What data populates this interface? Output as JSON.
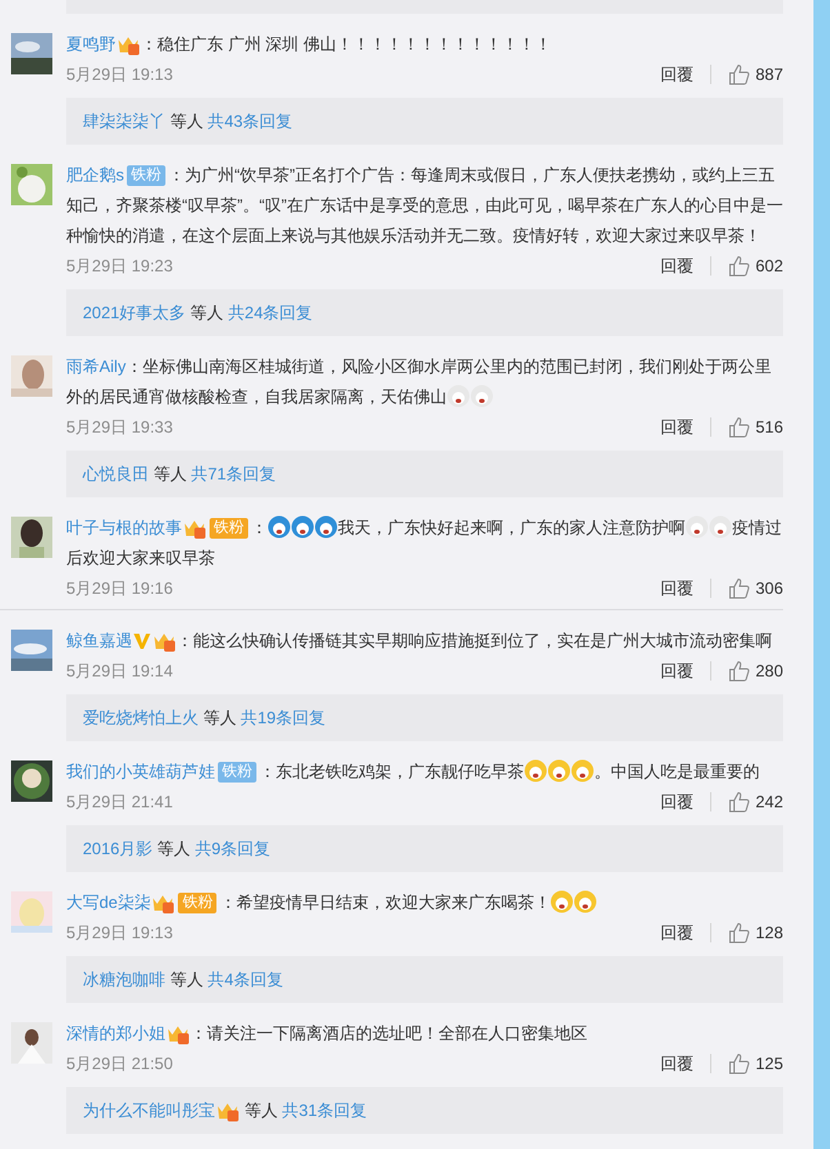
{
  "partial_reply_panel": true,
  "comments": [
    {
      "user": "夏鸣野",
      "badges": [
        {
          "kind": "crown"
        }
      ],
      "content": [
        {
          "kind": "text",
          "text": "：稳住广东 广州 深圳 佛山！！！！！！！！！！！！！"
        }
      ],
      "time": "5月29日 19:13",
      "reply_label": "回覆",
      "likes": "887",
      "replies": {
        "users": [
          {
            "name": "肆柒柒柒丫"
          }
        ],
        "suffix": "等人",
        "total": "共43条回复"
      }
    },
    {
      "user": "肥企鹅s",
      "badges": [
        {
          "kind": "fan",
          "text": "铁粉",
          "color": "#7ab8ea"
        }
      ],
      "content": [
        {
          "kind": "text",
          "text": "：为广州“饮早茶”正名打个广告：每逢周末或假日，广东人便扶老携幼，或约上三五知己，齐聚茶楼“叹早茶”。“叹”在广东话中是享受的意思，由此可见，喝早茶在广东人的心目中是一种愉快的消遣，在这个层面上来说与其他娱乐活动并无二致。疫情好转，欢迎大家过来叹早茶！"
        }
      ],
      "time": "5月29日 19:23",
      "reply_label": "回覆",
      "likes": "602",
      "replies": {
        "users": [
          {
            "name": "2021好事太多"
          }
        ],
        "suffix": "等人",
        "total": "共24条回复"
      }
    },
    {
      "user": "雨希Aily",
      "content": [
        {
          "kind": "text",
          "text": "：坐标佛山南海区桂城街道，风险小区御水岸两公里内的范围已封闭，我们刚处于两公里外的居民通宵做核酸检查，自我居家隔离，天佑佛山"
        },
        {
          "kind": "emoticon",
          "color": "#e8e8e8"
        },
        {
          "kind": "emoticon",
          "color": "#e8e8e8"
        }
      ],
      "time": "5月29日 19:33",
      "reply_label": "回覆",
      "likes": "516",
      "replies": {
        "users": [
          {
            "name": "心悦良田"
          }
        ],
        "suffix": "等人",
        "total": "共71条回复"
      }
    },
    {
      "user": "叶子与根的故事",
      "badges": [
        {
          "kind": "crown"
        },
        {
          "kind": "fan",
          "text": "铁粉",
          "color": "#f5a623"
        }
      ],
      "content": [
        {
          "kind": "text",
          "text": "："
        },
        {
          "kind": "emoticon",
          "color": "#2f8fd8"
        },
        {
          "kind": "emoticon",
          "color": "#2f8fd8"
        },
        {
          "kind": "emoticon",
          "color": "#2f8fd8"
        },
        {
          "kind": "text",
          "text": "我天，广东快好起来啊，广东的家人注意防护啊"
        },
        {
          "kind": "emoticon",
          "color": "#e8e8e8"
        },
        {
          "kind": "emoticon",
          "color": "#e8e8e8"
        },
        {
          "kind": "text",
          "text": "疫情过后欢迎大家来叹早茶"
        }
      ],
      "time": "5月29日 19:16",
      "reply_label": "回覆",
      "likes": "306"
    },
    {
      "user": "鲸鱼嘉遇",
      "badges": [
        {
          "kind": "verified"
        },
        {
          "kind": "crown"
        }
      ],
      "content": [
        {
          "kind": "text",
          "text": "：能这么快确认传播链其实早期响应措施挺到位了，实在是广州大城市流动密集啊"
        }
      ],
      "time": "5月29日 19:14",
      "reply_label": "回覆",
      "likes": "280",
      "replies": {
        "users": [
          {
            "name": "爱吃烧烤怕上火"
          }
        ],
        "suffix": "等人",
        "total": "共19条回复"
      }
    },
    {
      "user": "我们的小英雄葫芦娃",
      "badges": [
        {
          "kind": "fan",
          "text": "铁粉",
          "color": "#7ab8ea"
        }
      ],
      "content": [
        {
          "kind": "text",
          "text": "：东北老铁吃鸡架，广东靓仔吃早茶"
        },
        {
          "kind": "emoticon",
          "color": "#f7c62f"
        },
        {
          "kind": "emoticon",
          "color": "#f7c62f"
        },
        {
          "kind": "emoticon",
          "color": "#f7c62f"
        },
        {
          "kind": "text",
          "text": "。中国人吃是最重要的"
        }
      ],
      "time": "5月29日 21:41",
      "reply_label": "回覆",
      "likes": "242",
      "replies": {
        "users": [
          {
            "name": "2016月影"
          }
        ],
        "suffix": "等人",
        "total": "共9条回复"
      }
    },
    {
      "user": "大写de柒柒",
      "badges": [
        {
          "kind": "crown"
        },
        {
          "kind": "fan",
          "text": "铁粉",
          "color": "#f5a623"
        }
      ],
      "content": [
        {
          "kind": "text",
          "text": "：希望疫情早日结束，欢迎大家来广东喝茶！"
        },
        {
          "kind": "emoticon",
          "color": "#f7c62f"
        },
        {
          "kind": "emoticon",
          "color": "#f7c62f"
        }
      ],
      "time": "5月29日 19:13",
      "reply_label": "回覆",
      "likes": "128",
      "replies": {
        "users": [
          {
            "name": "冰糖泡咖啡"
          }
        ],
        "suffix": "等人",
        "total": "共4条回复"
      }
    },
    {
      "user": "深情的郑小姐",
      "badges": [
        {
          "kind": "crown"
        }
      ],
      "content": [
        {
          "kind": "text",
          "text": "：请关注一下隔离酒店的选址吧！全部在人口密集地区"
        }
      ],
      "time": "5月29日 21:50",
      "reply_label": "回覆",
      "likes": "125",
      "replies": {
        "users": [
          {
            "name": "为什么不能叫彤宝",
            "crown": true
          }
        ],
        "suffix": "等人",
        "total": "共31条回复"
      }
    }
  ]
}
